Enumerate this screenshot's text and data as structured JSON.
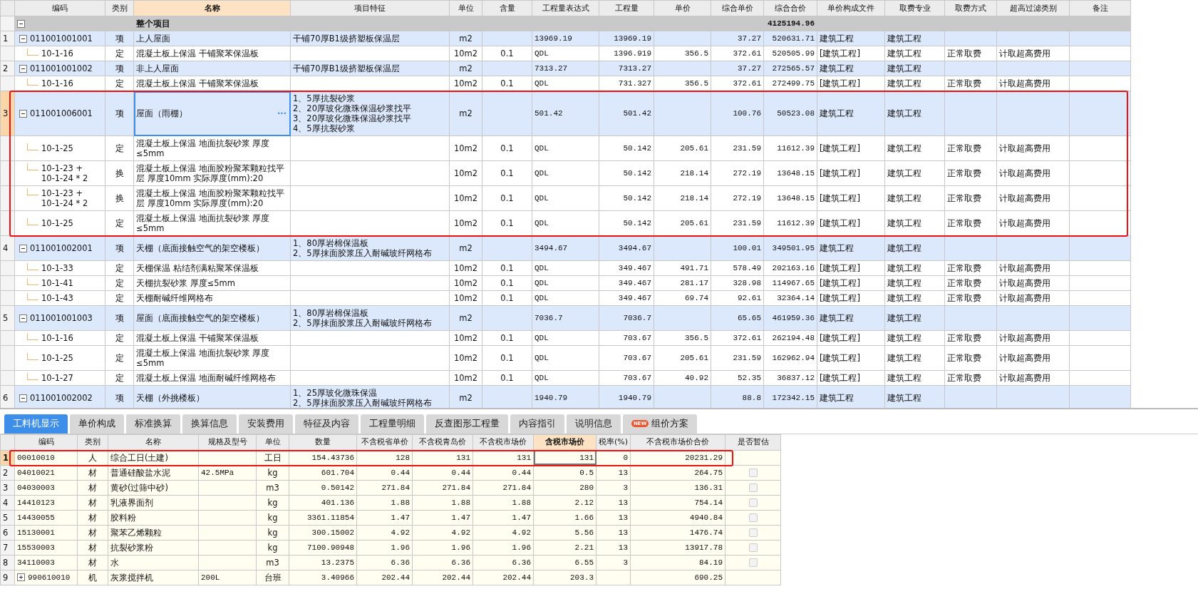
{
  "main_table": {
    "columns": [
      {
        "label": "编码",
        "active": false
      },
      {
        "label": "类别",
        "active": false
      },
      {
        "label": "名称",
        "active": true
      },
      {
        "label": "项目特征",
        "active": false
      },
      {
        "label": "单位",
        "active": false
      },
      {
        "label": "含量",
        "active": false
      },
      {
        "label": "工程量表达式",
        "active": false
      },
      {
        "label": "工程量",
        "active": false
      },
      {
        "label": "单价",
        "active": false
      },
      {
        "label": "综合单价",
        "active": false
      },
      {
        "label": "综合合价",
        "active": false
      },
      {
        "label": "单价构成文件",
        "active": false
      },
      {
        "label": "取费专业",
        "active": false
      },
      {
        "label": "取费方式",
        "active": false
      },
      {
        "label": "超高过滤类别",
        "active": false
      },
      {
        "label": "备注",
        "active": false
      }
    ],
    "rows": [
      {
        "kind": "total",
        "expanded": true,
        "selected": false,
        "name": "整个项目",
        "amount": "4125194.96"
      },
      {
        "kind": "item",
        "no": "1",
        "expanded": true,
        "selected": false,
        "code": "011001001001",
        "type": "项",
        "name": "上人屋面",
        "feature": "干铺70厚B1级挤塑板保温层",
        "unit": "m2",
        "expr": "13969.19",
        "qty": "13969.19",
        "unit_price": "37.27",
        "amount": "520631.71",
        "file": "建筑工程",
        "major": "建筑工程"
      },
      {
        "kind": "sub",
        "selected": false,
        "code": "10-1-16",
        "type": "定",
        "name": "混凝土板上保温 干铺聚苯保温板",
        "unit": "10m2",
        "ratio": "0.1",
        "expr": "QDL",
        "qty": "1396.919",
        "price": "356.5",
        "unit_price": "372.61",
        "amount": "520505.99",
        "file": "[建筑工程]",
        "major": "建筑工程",
        "fee_mode": "正常取费",
        "filter": "计取超高费用"
      },
      {
        "kind": "item",
        "no": "2",
        "expanded": true,
        "selected": false,
        "code": "011001001002",
        "type": "项",
        "name": "非上人屋面",
        "feature": "干铺70厚B1级挤塑板保温层",
        "unit": "m2",
        "expr": "7313.27",
        "qty": "7313.27",
        "unit_price": "37.27",
        "amount": "272565.57",
        "file": "建筑工程",
        "major": "建筑工程"
      },
      {
        "kind": "sub",
        "selected": false,
        "code": "10-1-16",
        "type": "定",
        "name": "混凝土板上保温 干铺聚苯保温板",
        "unit": "10m2",
        "ratio": "0.1",
        "expr": "QDL",
        "qty": "731.327",
        "price": "356.5",
        "unit_price": "372.61",
        "amount": "272499.75",
        "file": "[建筑工程]",
        "major": "建筑工程",
        "fee_mode": "正常取费",
        "filter": "计取超高费用"
      },
      {
        "kind": "item",
        "no": "3",
        "expanded": true,
        "selected": true,
        "more": "···",
        "code": "011001006001",
        "type": "项",
        "name": "屋面（雨棚）",
        "feature": "1、5厚抗裂砂浆\n2、20厚玻化微珠保温砂浆找平\n3、20厚玻化微珠保温砂浆找平\n4、5厚抗裂砂浆",
        "unit": "m2",
        "expr": "501.42",
        "qty": "501.42",
        "unit_price": "100.76",
        "amount": "50523.08",
        "file": "建筑工程",
        "major": "建筑工程"
      },
      {
        "kind": "sub",
        "selected": false,
        "code": "10-1-25",
        "type": "定",
        "name": "混凝土板上保温 地面抗裂砂浆 厚度≤5mm",
        "unit": "10m2",
        "ratio": "0.1",
        "expr": "QDL",
        "qty": "50.142",
        "price": "205.61",
        "unit_price": "231.59",
        "amount": "11612.39",
        "file": "[建筑工程]",
        "major": "建筑工程",
        "fee_mode": "正常取费",
        "filter": "计取超高费用"
      },
      {
        "kind": "sub",
        "selected": false,
        "code": "10-1-23 +\n10-1-24 * 2",
        "type": "换",
        "name": "混凝土板上保温 地面胶粉聚苯颗粒找平层 厚度10mm  实际厚度(mm):20",
        "unit": "10m2",
        "ratio": "0.1",
        "expr": "QDL",
        "qty": "50.142",
        "price": "218.14",
        "unit_price": "272.19",
        "amount": "13648.15",
        "file": "[建筑工程]",
        "major": "建筑工程",
        "fee_mode": "正常取费",
        "filter": "计取超高费用"
      },
      {
        "kind": "sub",
        "selected": false,
        "code": "10-1-23 +\n10-1-24 * 2",
        "type": "换",
        "name": "混凝土板上保温 地面胶粉聚苯颗粒找平层 厚度10mm  实际厚度(mm):20",
        "unit": "10m2",
        "ratio": "0.1",
        "expr": "QDL",
        "qty": "50.142",
        "price": "218.14",
        "unit_price": "272.19",
        "amount": "13648.15",
        "file": "[建筑工程]",
        "major": "建筑工程",
        "fee_mode": "正常取费",
        "filter": "计取超高费用"
      },
      {
        "kind": "sub",
        "selected": false,
        "code": "10-1-25",
        "type": "定",
        "name": "混凝土板上保温 地面抗裂砂浆 厚度≤5mm",
        "unit": "10m2",
        "ratio": "0.1",
        "expr": "QDL",
        "qty": "50.142",
        "price": "205.61",
        "unit_price": "231.59",
        "amount": "11612.39",
        "file": "[建筑工程]",
        "major": "建筑工程",
        "fee_mode": "正常取费",
        "filter": "计取超高费用"
      },
      {
        "kind": "item",
        "no": "4",
        "expanded": true,
        "selected": false,
        "code": "011001002001",
        "type": "项",
        "name": "天棚（底面接触空气的架空楼板）",
        "feature": "1、80厚岩棉保温板\n2、5厚抹面胶浆压入耐碱玻纤网格布",
        "unit": "m2",
        "expr": "3494.67",
        "qty": "3494.67",
        "unit_price": "100.01",
        "amount": "349501.95",
        "file": "建筑工程",
        "major": "建筑工程"
      },
      {
        "kind": "sub",
        "selected": false,
        "code": "10-1-33",
        "type": "定",
        "name": "天棚保温 粘结剂满粘聚苯保温板",
        "unit": "10m2",
        "ratio": "0.1",
        "expr": "QDL",
        "qty": "349.467",
        "price": "491.71",
        "unit_price": "578.49",
        "amount": "202163.16",
        "file": "[建筑工程]",
        "major": "建筑工程",
        "fee_mode": "正常取费",
        "filter": "计取超高费用"
      },
      {
        "kind": "sub",
        "selected": false,
        "code": "10-1-41",
        "type": "定",
        "name": "天棚抗裂砂浆 厚度≤5mm",
        "unit": "10m2",
        "ratio": "0.1",
        "expr": "QDL",
        "qty": "349.467",
        "price": "281.17",
        "unit_price": "328.98",
        "amount": "114967.65",
        "file": "[建筑工程]",
        "major": "建筑工程",
        "fee_mode": "正常取费",
        "filter": "计取超高费用"
      },
      {
        "kind": "sub",
        "selected": false,
        "code": "10-1-43",
        "type": "定",
        "name": "天棚耐碱纤维网格布",
        "unit": "10m2",
        "ratio": "0.1",
        "expr": "QDL",
        "qty": "349.467",
        "price": "69.74",
        "unit_price": "92.61",
        "amount": "32364.14",
        "file": "[建筑工程]",
        "major": "建筑工程",
        "fee_mode": "正常取费",
        "filter": "计取超高费用"
      },
      {
        "kind": "item",
        "no": "5",
        "expanded": true,
        "selected": false,
        "code": "011001001003",
        "type": "项",
        "name": "屋面（底面接触空气的架空楼板）",
        "feature": "1、80厚岩棉保温板\n2、5厚抹面胶浆压入耐碱玻纤网格布",
        "unit": "m2",
        "expr": "7036.7",
        "qty": "7036.7",
        "unit_price": "65.65",
        "amount": "461959.36",
        "file": "建筑工程",
        "major": "建筑工程"
      },
      {
        "kind": "sub",
        "selected": false,
        "code": "10-1-16",
        "type": "定",
        "name": "混凝土板上保温 干铺聚苯保温板",
        "unit": "10m2",
        "ratio": "0.1",
        "expr": "QDL",
        "qty": "703.67",
        "price": "356.5",
        "unit_price": "372.61",
        "amount": "262194.48",
        "file": "[建筑工程]",
        "major": "建筑工程",
        "fee_mode": "正常取费",
        "filter": "计取超高费用"
      },
      {
        "kind": "sub",
        "selected": false,
        "code": "10-1-25",
        "type": "定",
        "name": "混凝土板上保温 地面抗裂砂浆 厚度≤5mm",
        "unit": "10m2",
        "ratio": "0.1",
        "expr": "QDL",
        "qty": "703.67",
        "price": "205.61",
        "unit_price": "231.59",
        "amount": "162962.94",
        "file": "[建筑工程]",
        "major": "建筑工程",
        "fee_mode": "正常取费",
        "filter": "计取超高费用"
      },
      {
        "kind": "sub",
        "selected": false,
        "code": "10-1-27",
        "type": "定",
        "name": "混凝土板上保温 地面耐碱纤维网格布",
        "unit": "10m2",
        "ratio": "0.1",
        "expr": "QDL",
        "qty": "703.67",
        "price": "40.92",
        "unit_price": "52.35",
        "amount": "36837.12",
        "file": "[建筑工程]",
        "major": "建筑工程",
        "fee_mode": "正常取费",
        "filter": "计取超高费用"
      },
      {
        "kind": "item",
        "no": "6",
        "expanded": true,
        "selected": false,
        "code": "011001002002",
        "type": "项",
        "name": "天棚（外挑楼板）",
        "feature": "1、25厚玻化微珠保温\n2、5厚抹面胶浆压入耐碱玻纤网格布",
        "unit": "m2",
        "expr": "1940.79",
        "qty": "1940.79",
        "unit_price": "88.8",
        "amount": "172342.15",
        "file": "建筑工程",
        "major": "建筑工程"
      }
    ]
  },
  "detail_tabs": [
    {
      "label": "工料机显示",
      "selected": true
    },
    {
      "label": "单价构成",
      "selected": false
    },
    {
      "label": "标准换算",
      "selected": false
    },
    {
      "label": "换算信息",
      "selected": false
    },
    {
      "label": "安装费用",
      "selected": false
    },
    {
      "label": "特征及内容",
      "selected": false
    },
    {
      "label": "工程量明细",
      "selected": false
    },
    {
      "label": "反查图形工程量",
      "selected": false
    },
    {
      "label": "内容指引",
      "selected": false
    },
    {
      "label": "说明信息",
      "selected": false
    },
    {
      "label": "组价方案",
      "selected": false,
      "badge": "NEW"
    }
  ],
  "detail_table": {
    "columns": [
      {
        "label": "编码",
        "active": false
      },
      {
        "label": "类别",
        "active": false
      },
      {
        "label": "名称",
        "active": false
      },
      {
        "label": "规格及型号",
        "active": false
      },
      {
        "label": "单位",
        "active": false
      },
      {
        "label": "数量",
        "active": false
      },
      {
        "label": "不含税省单价",
        "active": false
      },
      {
        "label": "不含税青岛价",
        "active": false
      },
      {
        "label": "不含税市场价",
        "active": false
      },
      {
        "label": "含税市场价",
        "active": true
      },
      {
        "label": "税率(%)",
        "active": false
      },
      {
        "label": "不含税市场价合价",
        "active": false
      },
      {
        "label": "是否暂估",
        "active": false
      }
    ],
    "rows": [
      {
        "no": "1",
        "selected": true,
        "code": "00010010",
        "type": "人",
        "name": "综合工日(土建)",
        "unit": "工日",
        "qty": "154.43736",
        "p1": "128",
        "p2": "131",
        "p3": "131",
        "p4": "131",
        "rate": "0",
        "amount": "20231.29"
      },
      {
        "no": "2",
        "selected": false,
        "checked": false,
        "code": "04010021",
        "type": "材",
        "name": "普通硅酸盐水泥",
        "spec": "42.5MPa",
        "unit": "kg",
        "qty": "601.704",
        "p1": "0.44",
        "p2": "0.44",
        "p3": "0.44",
        "p4": "0.5",
        "rate": "13",
        "amount": "264.75"
      },
      {
        "no": "3",
        "selected": false,
        "checked": false,
        "code": "04030003",
        "type": "材",
        "name": "黄砂(过筛中砂)",
        "unit": "m3",
        "qty": "0.50142",
        "p1": "271.84",
        "p2": "271.84",
        "p3": "271.84",
        "p4": "280",
        "rate": "3",
        "amount": "136.31"
      },
      {
        "no": "4",
        "selected": false,
        "checked": false,
        "code": "14410123",
        "type": "材",
        "name": "乳液界面剂",
        "unit": "kg",
        "qty": "401.136",
        "p1": "1.88",
        "p2": "1.88",
        "p3": "1.88",
        "p4": "2.12",
        "rate": "13",
        "amount": "754.14"
      },
      {
        "no": "5",
        "selected": false,
        "checked": false,
        "code": "14430055",
        "type": "材",
        "name": "胶料粉",
        "unit": "kg",
        "qty": "3361.11854",
        "p1": "1.47",
        "p2": "1.47",
        "p3": "1.47",
        "p4": "1.66",
        "rate": "13",
        "amount": "4940.84"
      },
      {
        "no": "6",
        "selected": false,
        "checked": false,
        "code": "15130001",
        "type": "材",
        "name": "聚苯乙烯颗粒",
        "unit": "kg",
        "qty": "300.15002",
        "p1": "4.92",
        "p2": "4.92",
        "p3": "4.92",
        "p4": "5.56",
        "rate": "13",
        "amount": "1476.74"
      },
      {
        "no": "7",
        "selected": false,
        "checked": false,
        "code": "15530003",
        "type": "材",
        "name": "抗裂砂浆粉",
        "unit": "kg",
        "qty": "7100.90948",
        "p1": "1.96",
        "p2": "1.96",
        "p3": "1.96",
        "p4": "2.21",
        "rate": "13",
        "amount": "13917.78"
      },
      {
        "no": "8",
        "selected": false,
        "checked": false,
        "code": "34110003",
        "type": "材",
        "name": "水",
        "unit": "m3",
        "qty": "13.2375",
        "p1": "6.36",
        "p2": "6.36",
        "p3": "6.36",
        "p4": "6.55",
        "rate": "3",
        "amount": "84.19"
      },
      {
        "no": "9",
        "selected": false,
        "expanded": false,
        "code": "990610010",
        "type": "机",
        "name": "灰浆搅拌机",
        "spec": "200L",
        "unit": "台班",
        "qty": "3.40966",
        "p1": "202.44",
        "p2": "202.44",
        "p3": "202.44",
        "p4": "203.3",
        "amount": "690.25"
      }
    ]
  }
}
